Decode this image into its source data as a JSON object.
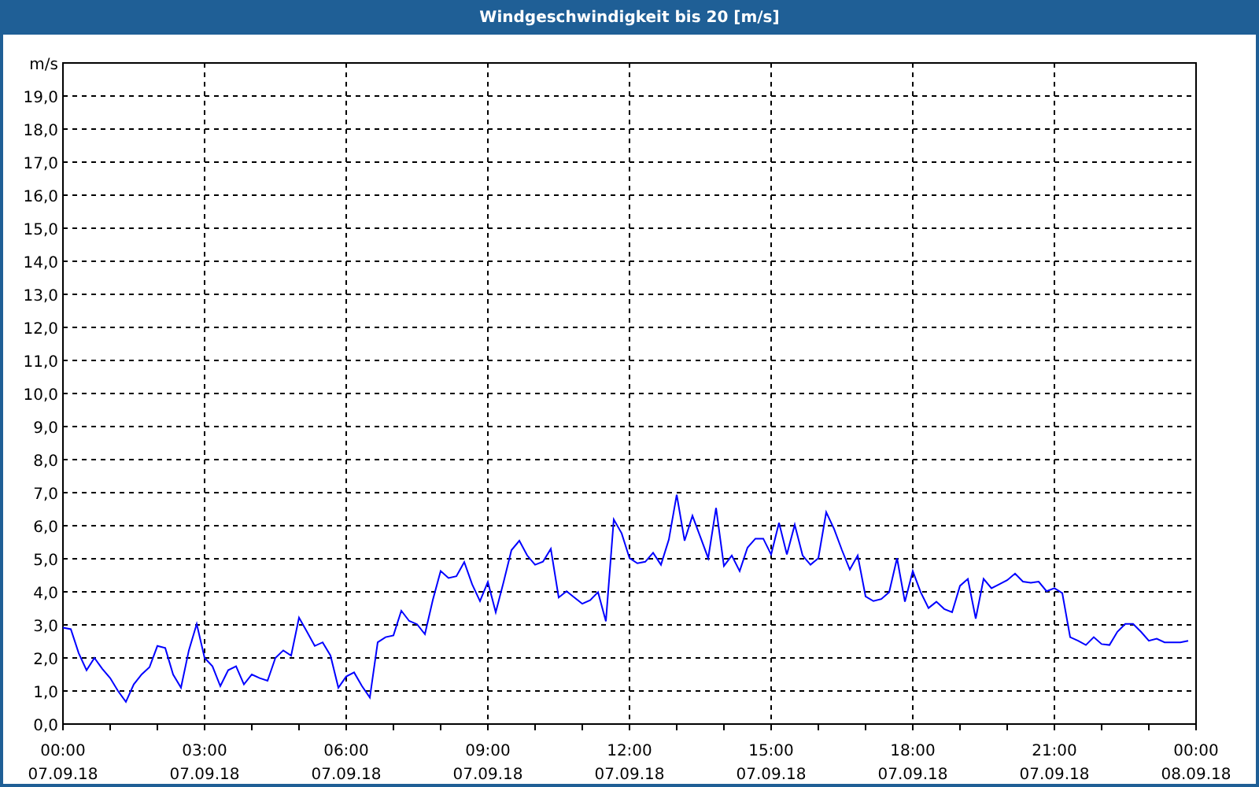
{
  "window": {
    "title": "Windgeschwindigkeit bis 20 [m/s]"
  },
  "chart": {
    "chart_data": {
      "type": "line",
      "ylabel": "m/s",
      "ylim": [
        0,
        20
      ],
      "grid": true,
      "yticks": [
        {
          "value": 0,
          "label": "0,0"
        },
        {
          "value": 1,
          "label": "1,0"
        },
        {
          "value": 2,
          "label": "2,0"
        },
        {
          "value": 3,
          "label": "3,0"
        },
        {
          "value": 4,
          "label": "4,0"
        },
        {
          "value": 5,
          "label": "5,0"
        },
        {
          "value": 6,
          "label": "6,0"
        },
        {
          "value": 7,
          "label": "7,0"
        },
        {
          "value": 8,
          "label": "8,0"
        },
        {
          "value": 9,
          "label": "9,0"
        },
        {
          "value": 10,
          "label": "10,0"
        },
        {
          "value": 11,
          "label": "11,0"
        },
        {
          "value": 12,
          "label": "12,0"
        },
        {
          "value": 13,
          "label": "13,0"
        },
        {
          "value": 14,
          "label": "14,0"
        },
        {
          "value": 15,
          "label": "15,0"
        },
        {
          "value": 16,
          "label": "16,0"
        },
        {
          "value": 17,
          "label": "17,0"
        },
        {
          "value": 18,
          "label": "18,0"
        },
        {
          "value": 19,
          "label": "19,0"
        }
      ],
      "categories": [
        "00:00 07.09.18",
        null,
        null,
        null,
        null,
        null,
        null,
        null,
        null,
        null,
        null,
        null,
        null,
        null,
        null,
        null,
        null,
        null,
        "03:00 07.09.18",
        null,
        null,
        null,
        null,
        null,
        null,
        null,
        null,
        null,
        null,
        null,
        null,
        null,
        null,
        null,
        null,
        null,
        "06:00 07.09.18",
        null,
        null,
        null,
        null,
        null,
        null,
        null,
        null,
        null,
        null,
        null,
        null,
        null,
        null,
        null,
        null,
        null,
        "09:00 07.09.18",
        null,
        null,
        null,
        null,
        null,
        null,
        null,
        null,
        null,
        null,
        null,
        null,
        null,
        null,
        null,
        null,
        null,
        "12:00 07.09.18",
        null,
        null,
        null,
        null,
        null,
        null,
        null,
        null,
        null,
        null,
        null,
        null,
        null,
        null,
        null,
        null,
        null,
        "15:00 07.09.18",
        null,
        null,
        null,
        null,
        null,
        null,
        null,
        null,
        null,
        null,
        null,
        null,
        null,
        null,
        null,
        null,
        null,
        "18:00 07.09.18",
        null,
        null,
        null,
        null,
        null,
        null,
        null,
        null,
        null,
        null,
        null,
        null,
        null,
        null,
        null,
        null,
        null,
        "21:00 07.09.18",
        null,
        null,
        null,
        null,
        null,
        null,
        null,
        null,
        null,
        null,
        null,
        null,
        null,
        null,
        null,
        null,
        null,
        "00:00 08.09.18"
      ],
      "series": [
        {
          "color": "#0000ff",
          "values": [
            2.92,
            2.87,
            2.15,
            1.63,
            2.0,
            1.67,
            1.39,
            1.0,
            0.67,
            1.2,
            1.5,
            1.72,
            2.36,
            2.3,
            1.5,
            1.1,
            2.23,
            3.03,
            2.0,
            1.75,
            1.15,
            1.63,
            1.75,
            1.2,
            1.5,
            1.39,
            1.31,
            2.0,
            2.23,
            2.07,
            3.22,
            2.8,
            2.36,
            2.47,
            2.07,
            1.1,
            1.44,
            1.56,
            1.15,
            0.8,
            2.47,
            2.63,
            2.68,
            3.43,
            3.12,
            3.02,
            2.72,
            3.75,
            4.63,
            4.42,
            4.47,
            4.9,
            4.23,
            3.72,
            4.3,
            3.38,
            4.3,
            5.26,
            5.55,
            5.1,
            4.82,
            4.91,
            5.3,
            3.83,
            4.02,
            3.83,
            3.64,
            3.75,
            3.99,
            3.11,
            6.19,
            5.77,
            5.02,
            4.86,
            4.91,
            5.18,
            4.82,
            5.58,
            6.94,
            5.55,
            6.3,
            5.66,
            5.02,
            6.54,
            4.78,
            5.1,
            4.63,
            5.34,
            5.61,
            5.61,
            5.13,
            6.09,
            5.13,
            6.03,
            5.1,
            4.82,
            5.02,
            6.41,
            5.9,
            5.26,
            4.67,
            5.1,
            3.86,
            3.72,
            3.78,
            3.99,
            5.02,
            3.7,
            4.63,
            3.99,
            3.51,
            3.7,
            3.48,
            3.38,
            4.18,
            4.39,
            3.19,
            4.39,
            4.11,
            4.23,
            4.35,
            4.55,
            4.31,
            4.27,
            4.31,
            4.02,
            4.11,
            3.96,
            2.63,
            2.52,
            2.39,
            2.63,
            2.42,
            2.39,
            2.79,
            3.03,
            3.03,
            2.79,
            2.52,
            2.58,
            2.47,
            2.47,
            2.47,
            2.52,
            null
          ]
        }
      ]
    }
  }
}
